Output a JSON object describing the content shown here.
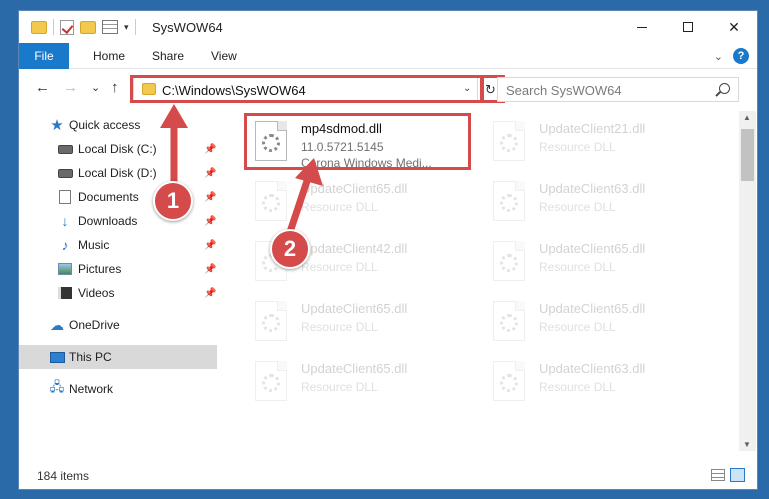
{
  "window": {
    "title": "SysWOW64",
    "minimize_icon": "minimize-icon",
    "maximize_icon": "maximize-icon",
    "close_glyph": "✕"
  },
  "ribbon": {
    "tabs": [
      "File",
      "Home",
      "Share",
      "View"
    ],
    "help_glyph": "?"
  },
  "nav": {
    "back_glyph": "←",
    "forward_glyph": "→",
    "recent_glyph": "⌄",
    "up_glyph": "↑",
    "address": "C:\\Windows\\SysWOW64",
    "search_placeholder": "Search SysWOW64"
  },
  "sidebar": {
    "items": [
      {
        "label": "Quick access",
        "icon": "star-icon",
        "pinned": false
      },
      {
        "label": "Local Disk (C:)",
        "icon": "disk-icon",
        "pinned": true
      },
      {
        "label": "Local Disk (D:)",
        "icon": "disk-icon",
        "pinned": true
      },
      {
        "label": "Documents",
        "icon": "documents-icon",
        "pinned": true
      },
      {
        "label": "Downloads",
        "icon": "download-icon",
        "pinned": true
      },
      {
        "label": "Music",
        "icon": "music-icon",
        "pinned": true
      },
      {
        "label": "Pictures",
        "icon": "pictures-icon",
        "pinned": true
      },
      {
        "label": "Videos",
        "icon": "videos-icon",
        "pinned": true
      },
      {
        "label": "OneDrive",
        "icon": "cloud-icon",
        "pinned": false
      },
      {
        "label": "This PC",
        "icon": "computer-icon",
        "pinned": false,
        "selected": true
      },
      {
        "label": "Network",
        "icon": "network-icon",
        "pinned": false
      }
    ]
  },
  "files": [
    {
      "name": "mp4sdmod.dll",
      "line2": "11.0.5721.5145",
      "line3": "Corona Windows Medi..."
    },
    {
      "name": "UpdateClient21.dll",
      "line2": "Resource DLL"
    },
    {
      "name": "UpdateClient65.dll",
      "line2": "Resource DLL"
    },
    {
      "name": "UpdateClient63.dll",
      "line2": "Resource DLL"
    },
    {
      "name": "UpdateClient42.dll",
      "line2": "Resource DLL"
    },
    {
      "name": "UpdateClient65.dll",
      "line2": "Resource DLL"
    },
    {
      "name": "UpdateClient65.dll",
      "line2": "Resource DLL"
    },
    {
      "name": "UpdateClient65.dll",
      "line2": "Resource DLL"
    },
    {
      "name": "UpdateClient65.dll",
      "line2": "Resource DLL"
    },
    {
      "name": "UpdateClient63.dll",
      "line2": "Resource DLL"
    }
  ],
  "status": {
    "item_count": "184 items"
  },
  "annotations": {
    "step1": "1",
    "step2": "2",
    "color": "#d54a4a"
  }
}
